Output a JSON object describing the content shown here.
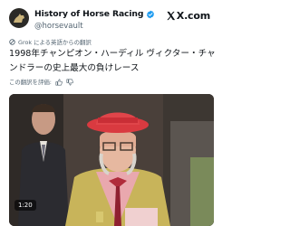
{
  "post": {
    "display_name": "History of Horse Racing",
    "handle": "@horsevault",
    "brand": "X.com",
    "translation_note": "Grok による英語からの翻訳",
    "text": "1998年チャンピオン・ハーディル ヴィクター・チャンドラーの史上最大の負けレース",
    "rate_label": "この翻訳を評価:",
    "video": {
      "timestamp": "1:20"
    }
  },
  "colors": {
    "verified": "#1d9bf0",
    "secondary_text": "#536471"
  }
}
